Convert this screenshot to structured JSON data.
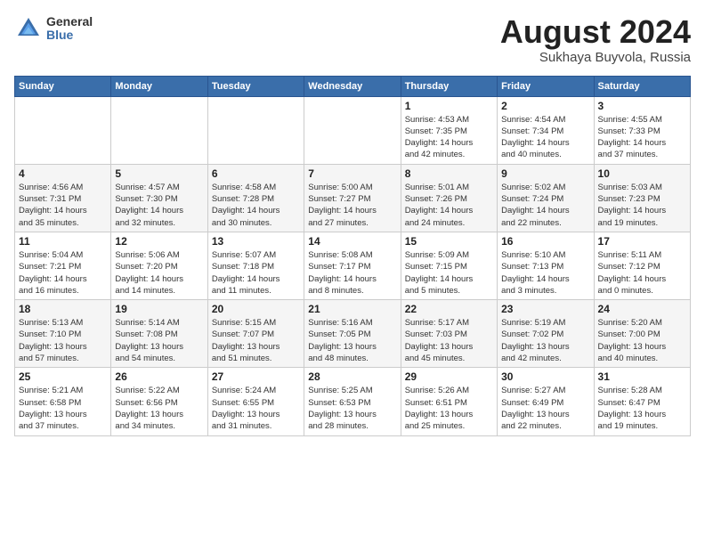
{
  "header": {
    "logo_general": "General",
    "logo_blue": "Blue",
    "month_year": "August 2024",
    "location": "Sukhaya Buyvola, Russia"
  },
  "calendar": {
    "days_of_week": [
      "Sunday",
      "Monday",
      "Tuesday",
      "Wednesday",
      "Thursday",
      "Friday",
      "Saturday"
    ],
    "weeks": [
      [
        {
          "day": "",
          "detail": ""
        },
        {
          "day": "",
          "detail": ""
        },
        {
          "day": "",
          "detail": ""
        },
        {
          "day": "",
          "detail": ""
        },
        {
          "day": "1",
          "detail": "Sunrise: 4:53 AM\nSunset: 7:35 PM\nDaylight: 14 hours\nand 42 minutes."
        },
        {
          "day": "2",
          "detail": "Sunrise: 4:54 AM\nSunset: 7:34 PM\nDaylight: 14 hours\nand 40 minutes."
        },
        {
          "day": "3",
          "detail": "Sunrise: 4:55 AM\nSunset: 7:33 PM\nDaylight: 14 hours\nand 37 minutes."
        }
      ],
      [
        {
          "day": "4",
          "detail": "Sunrise: 4:56 AM\nSunset: 7:31 PM\nDaylight: 14 hours\nand 35 minutes."
        },
        {
          "day": "5",
          "detail": "Sunrise: 4:57 AM\nSunset: 7:30 PM\nDaylight: 14 hours\nand 32 minutes."
        },
        {
          "day": "6",
          "detail": "Sunrise: 4:58 AM\nSunset: 7:28 PM\nDaylight: 14 hours\nand 30 minutes."
        },
        {
          "day": "7",
          "detail": "Sunrise: 5:00 AM\nSunset: 7:27 PM\nDaylight: 14 hours\nand 27 minutes."
        },
        {
          "day": "8",
          "detail": "Sunrise: 5:01 AM\nSunset: 7:26 PM\nDaylight: 14 hours\nand 24 minutes."
        },
        {
          "day": "9",
          "detail": "Sunrise: 5:02 AM\nSunset: 7:24 PM\nDaylight: 14 hours\nand 22 minutes."
        },
        {
          "day": "10",
          "detail": "Sunrise: 5:03 AM\nSunset: 7:23 PM\nDaylight: 14 hours\nand 19 minutes."
        }
      ],
      [
        {
          "day": "11",
          "detail": "Sunrise: 5:04 AM\nSunset: 7:21 PM\nDaylight: 14 hours\nand 16 minutes."
        },
        {
          "day": "12",
          "detail": "Sunrise: 5:06 AM\nSunset: 7:20 PM\nDaylight: 14 hours\nand 14 minutes."
        },
        {
          "day": "13",
          "detail": "Sunrise: 5:07 AM\nSunset: 7:18 PM\nDaylight: 14 hours\nand 11 minutes."
        },
        {
          "day": "14",
          "detail": "Sunrise: 5:08 AM\nSunset: 7:17 PM\nDaylight: 14 hours\nand 8 minutes."
        },
        {
          "day": "15",
          "detail": "Sunrise: 5:09 AM\nSunset: 7:15 PM\nDaylight: 14 hours\nand 5 minutes."
        },
        {
          "day": "16",
          "detail": "Sunrise: 5:10 AM\nSunset: 7:13 PM\nDaylight: 14 hours\nand 3 minutes."
        },
        {
          "day": "17",
          "detail": "Sunrise: 5:11 AM\nSunset: 7:12 PM\nDaylight: 14 hours\nand 0 minutes."
        }
      ],
      [
        {
          "day": "18",
          "detail": "Sunrise: 5:13 AM\nSunset: 7:10 PM\nDaylight: 13 hours\nand 57 minutes."
        },
        {
          "day": "19",
          "detail": "Sunrise: 5:14 AM\nSunset: 7:08 PM\nDaylight: 13 hours\nand 54 minutes."
        },
        {
          "day": "20",
          "detail": "Sunrise: 5:15 AM\nSunset: 7:07 PM\nDaylight: 13 hours\nand 51 minutes."
        },
        {
          "day": "21",
          "detail": "Sunrise: 5:16 AM\nSunset: 7:05 PM\nDaylight: 13 hours\nand 48 minutes."
        },
        {
          "day": "22",
          "detail": "Sunrise: 5:17 AM\nSunset: 7:03 PM\nDaylight: 13 hours\nand 45 minutes."
        },
        {
          "day": "23",
          "detail": "Sunrise: 5:19 AM\nSunset: 7:02 PM\nDaylight: 13 hours\nand 42 minutes."
        },
        {
          "day": "24",
          "detail": "Sunrise: 5:20 AM\nSunset: 7:00 PM\nDaylight: 13 hours\nand 40 minutes."
        }
      ],
      [
        {
          "day": "25",
          "detail": "Sunrise: 5:21 AM\nSunset: 6:58 PM\nDaylight: 13 hours\nand 37 minutes."
        },
        {
          "day": "26",
          "detail": "Sunrise: 5:22 AM\nSunset: 6:56 PM\nDaylight: 13 hours\nand 34 minutes."
        },
        {
          "day": "27",
          "detail": "Sunrise: 5:24 AM\nSunset: 6:55 PM\nDaylight: 13 hours\nand 31 minutes."
        },
        {
          "day": "28",
          "detail": "Sunrise: 5:25 AM\nSunset: 6:53 PM\nDaylight: 13 hours\nand 28 minutes."
        },
        {
          "day": "29",
          "detail": "Sunrise: 5:26 AM\nSunset: 6:51 PM\nDaylight: 13 hours\nand 25 minutes."
        },
        {
          "day": "30",
          "detail": "Sunrise: 5:27 AM\nSunset: 6:49 PM\nDaylight: 13 hours\nand 22 minutes."
        },
        {
          "day": "31",
          "detail": "Sunrise: 5:28 AM\nSunset: 6:47 PM\nDaylight: 13 hours\nand 19 minutes."
        }
      ]
    ]
  }
}
